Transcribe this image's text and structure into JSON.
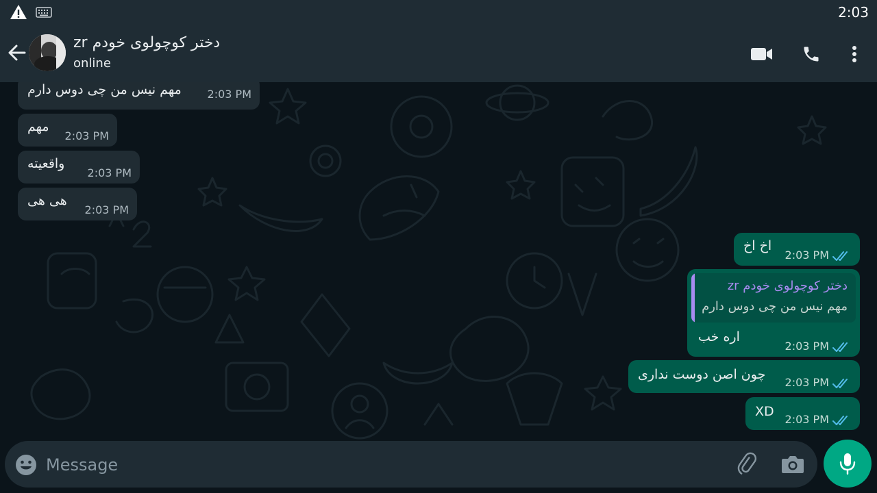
{
  "status_bar": {
    "time": "2:03"
  },
  "header": {
    "contact_name": "zr دختر کوچولوی خودم",
    "status": "online"
  },
  "messages": [
    {
      "direction": "incoming",
      "text": "مهم نیس من چی دوس دارم",
      "time": "2:03 PM"
    },
    {
      "direction": "incoming",
      "text": "مهم",
      "time": "2:03 PM"
    },
    {
      "direction": "incoming",
      "text": "واقعیته",
      "time": "2:03 PM"
    },
    {
      "direction": "incoming",
      "text": "هی هی",
      "time": "2:03 PM"
    },
    {
      "direction": "outgoing",
      "text": "اخ اخ",
      "time": "2:03 PM",
      "read": true
    },
    {
      "direction": "outgoing",
      "text": "اره خب",
      "time": "2:03 PM",
      "read": true,
      "reply_to": {
        "name": "zr دختر کوچولوی خودم",
        "text": "مهم نیس من چی دوس دارم"
      }
    },
    {
      "direction": "outgoing",
      "text": "چون اصن دوست نداری",
      "time": "2:03 PM",
      "read": true
    },
    {
      "direction": "outgoing",
      "text": "XD",
      "time": "2:03 PM",
      "read": true
    }
  ],
  "composer": {
    "placeholder": "Message"
  },
  "icons": {
    "status_bar": [
      "warning-icon",
      "keyboard-icon"
    ],
    "header": [
      "back-arrow-icon",
      "video-call-icon",
      "voice-call-icon",
      "more-options-icon"
    ],
    "composer": [
      "emoji-icon",
      "attach-icon",
      "camera-icon",
      "mic-icon"
    ],
    "read_receipt": "double-check-icon"
  },
  "colors": {
    "chat_background": "#0b141a",
    "header": "#1f2c34",
    "incoming_bubble": "#202c33",
    "outgoing_bubble": "#005c4b",
    "read_tick": "#53bdeb",
    "accent": "#00a884",
    "quote_name": "#a88bf0"
  }
}
